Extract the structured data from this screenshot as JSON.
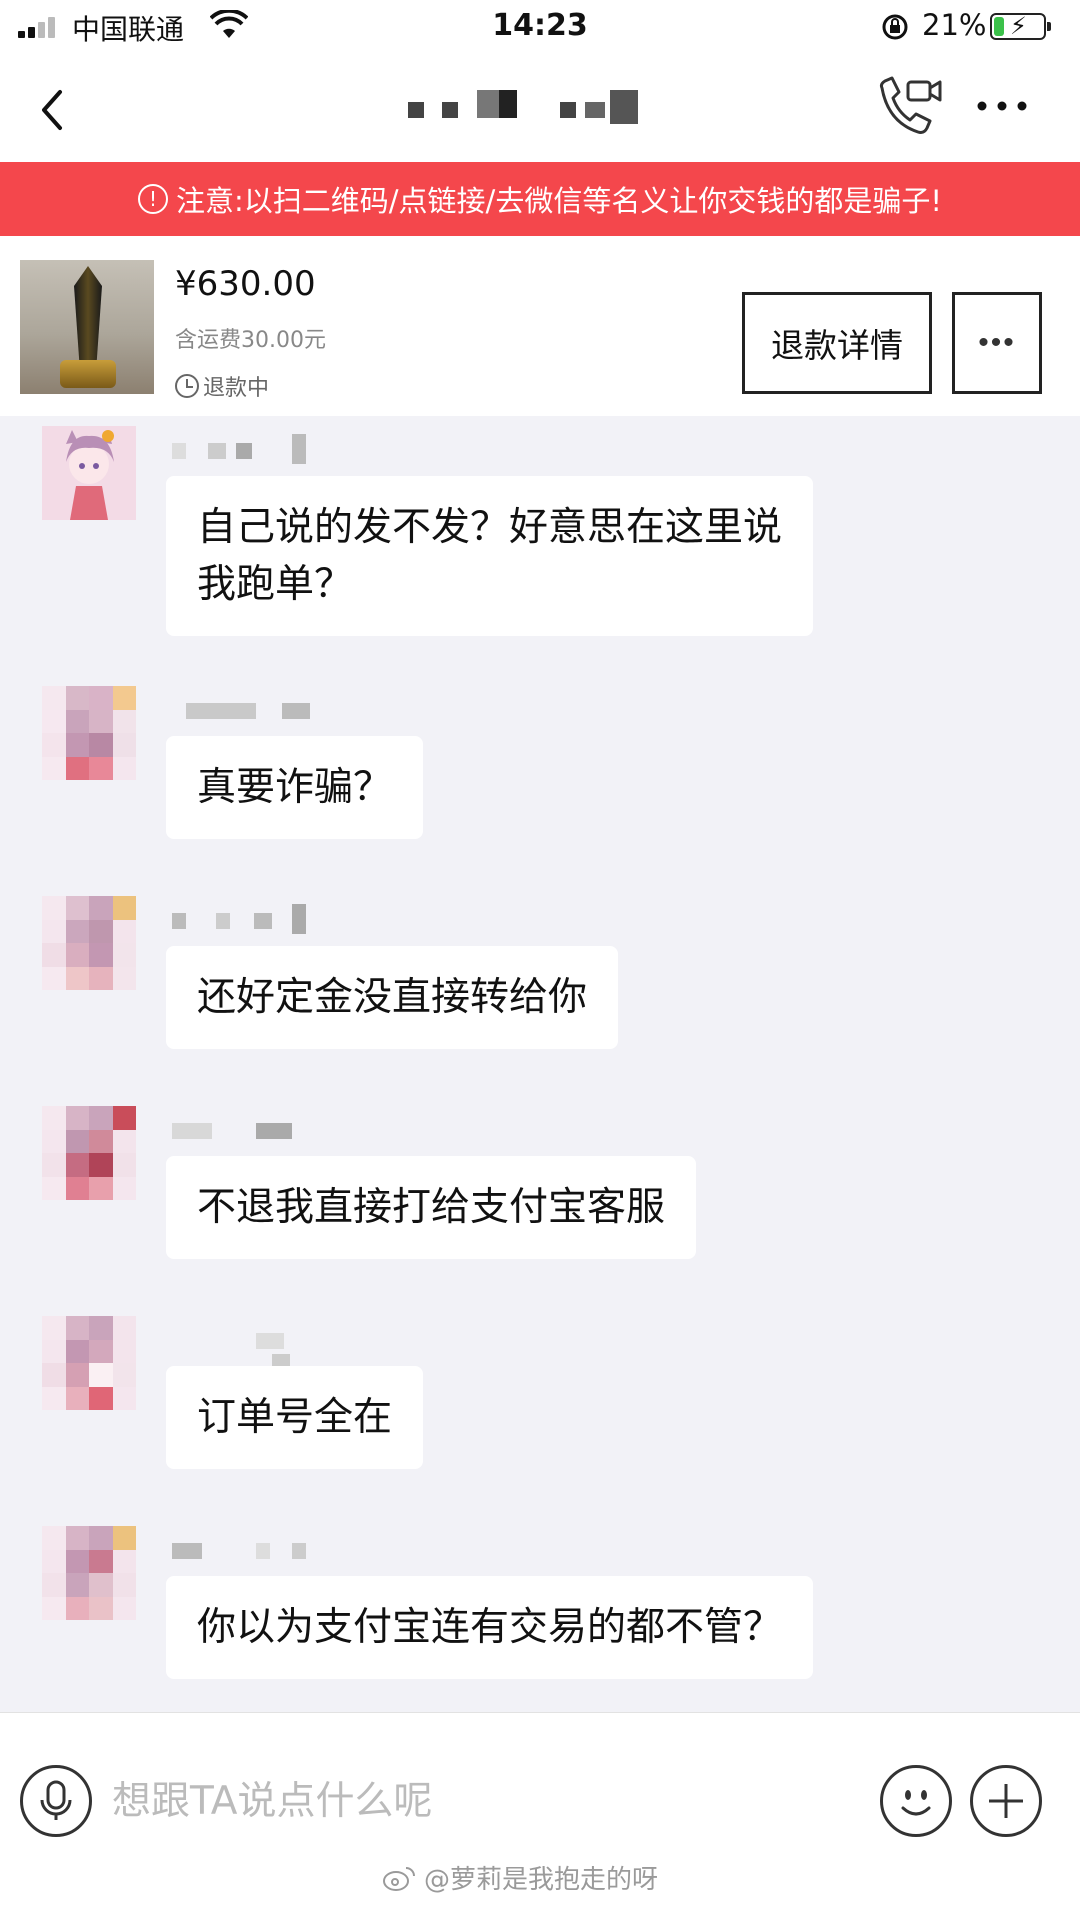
{
  "status_bar": {
    "carrier": "中国联通",
    "time": "14:23",
    "battery_percent": "21%",
    "battery_level": 0.21
  },
  "nav": {
    "back_icon": "chevron-left-icon",
    "call_icon": "phone-video-icon",
    "more_icon": "ellipsis-icon"
  },
  "warning": {
    "text": "注意:以扫二维码/点链接/去微信等名义让你交钱的都是骗子!"
  },
  "product": {
    "price": "¥630.00",
    "shipping": "含运费30.00元",
    "status": "退款中",
    "refund_detail_label": "退款详情",
    "more_label": "•••"
  },
  "messages": [
    {
      "text_lines": [
        "自己说的发不发？好意思在这里说",
        "我跑单？"
      ]
    },
    {
      "text_lines": [
        "真要诈骗？"
      ]
    },
    {
      "text_lines": [
        "还好定金没直接转给你"
      ]
    },
    {
      "text_lines": [
        "不退我直接打给支付宝客服"
      ]
    },
    {
      "text_lines": [
        "订单号全在"
      ]
    },
    {
      "text_lines": [
        "你以为支付宝连有交易的都不管？"
      ]
    }
  ],
  "input": {
    "placeholder": "想跟TA说点什么呢"
  },
  "watermark": {
    "text": "@萝莉是我抱走的呀"
  },
  "colors": {
    "warning_bg": "#f4474c",
    "chat_bg": "#f2f2f7",
    "battery_green": "#3bc14a"
  }
}
